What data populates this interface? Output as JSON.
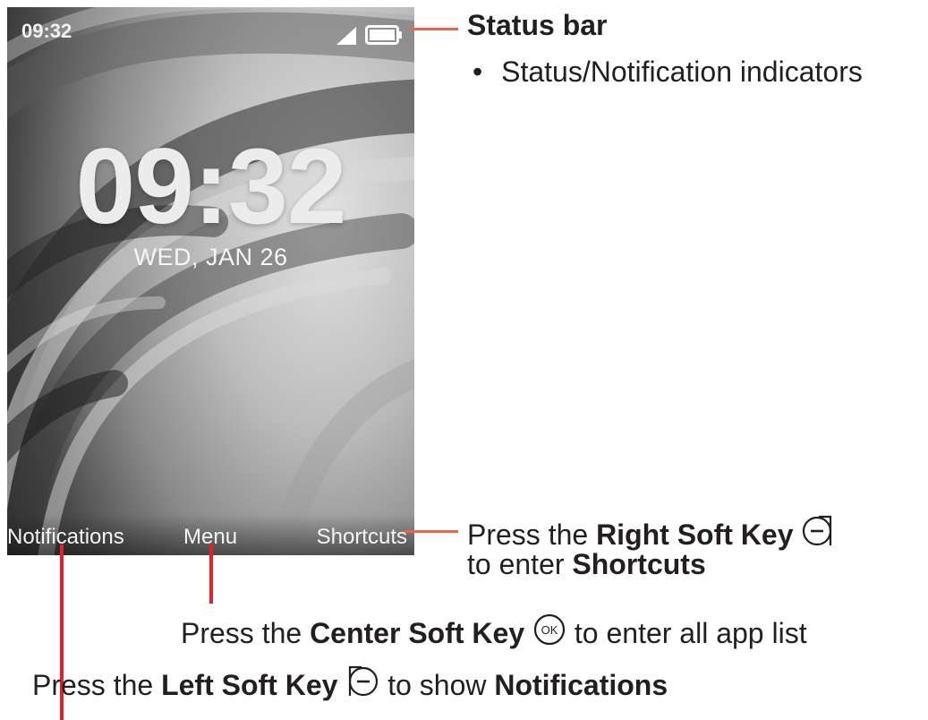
{
  "screen": {
    "status_time": "09:32",
    "clock": "09:32",
    "date": "WED, JAN 26",
    "soft_keys": {
      "left": "Notifications",
      "center": "Menu",
      "right": "Shortcuts"
    }
  },
  "callouts": {
    "status_bar": {
      "title": "Status bar",
      "bullet": "•",
      "item": "Status/Notification indicators"
    },
    "right_key": {
      "line1_pre": "Press the ",
      "line1_bold": "Right Soft Key",
      "line2_pre": "to enter ",
      "line2_bold": "Shortcuts"
    },
    "center_key": {
      "pre": "Press the ",
      "bold": "Center Soft Key",
      "post": " to enter all app list",
      "icon_label": "OK"
    },
    "left_key": {
      "pre": "Press the ",
      "bold": "Left Soft Key",
      "post_pre": " to show ",
      "post_bold": "Notifications"
    }
  },
  "colors": {
    "callout_orange": "#f0624a",
    "callout_red": "#e4202a",
    "text": "#231f20"
  },
  "icons": [
    "signal-icon",
    "battery-icon",
    "right-soft-key-icon",
    "ok-key-icon",
    "left-soft-key-icon"
  ]
}
